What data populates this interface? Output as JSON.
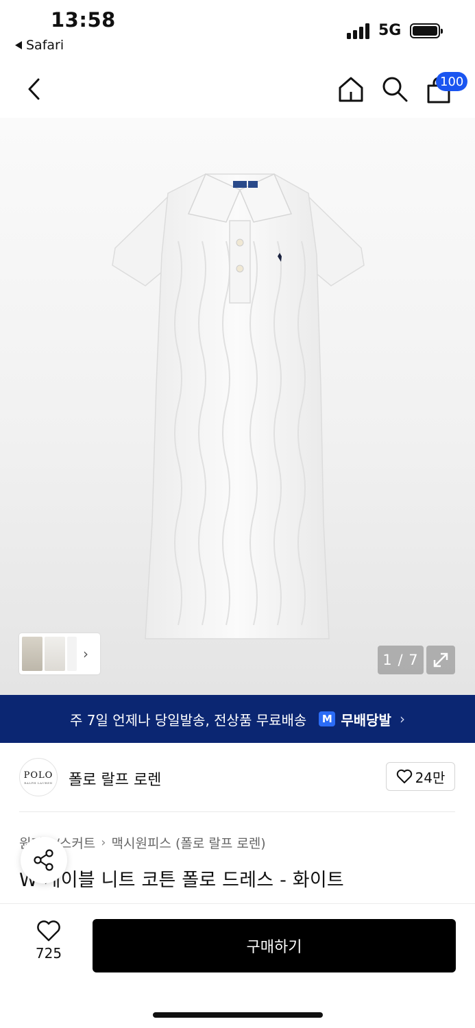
{
  "status_bar": {
    "time": "13:58",
    "back_app": "Safari",
    "network": "5G"
  },
  "nav": {
    "cart_count": "100"
  },
  "gallery": {
    "page_indicator": "1 / 7"
  },
  "banner": {
    "text": "주 7일 언제나 당일발송, 전상품 무료배송",
    "badge_letter": "M",
    "badge_text": "무배당발"
  },
  "brand": {
    "logo_text": "POLO",
    "logo_subtext": "RALPH LAUREN",
    "name": "폴로 랄프 로렌",
    "likes": "24만"
  },
  "breadcrumb": {
    "category": "원피스/스커트",
    "subcategory": "맥시원피스 (폴로 랄프 로렌)"
  },
  "product": {
    "title": "W 케이블 니트 코튼 폴로 드레스 - 화이트"
  },
  "bottom_bar": {
    "wish_count": "725",
    "buy_label": "구매하기"
  },
  "colors": {
    "banner_bg": "#0b2672",
    "accent_blue": "#1a55f0",
    "buy_bg": "#000000"
  }
}
